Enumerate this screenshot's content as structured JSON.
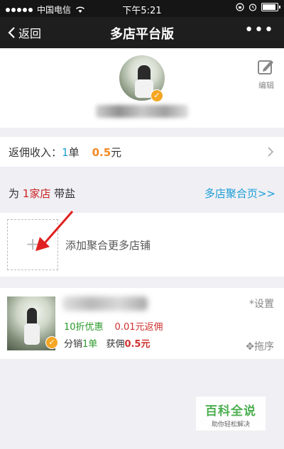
{
  "status_bar": {
    "carrier": "中国电信",
    "time": "下午5:21"
  },
  "nav": {
    "back_label": "返回",
    "title": "多店平台版",
    "more_label": "•••"
  },
  "profile": {
    "edit_label": "编辑"
  },
  "income": {
    "label": "返佣收入：",
    "orders_count": "1",
    "orders_unit": "单",
    "amount_value": "0.5",
    "amount_unit": "元"
  },
  "stores_header": {
    "prefix": "为 ",
    "count_text": "1家店",
    "suffix": " 带盐",
    "link_label": "多店聚合页>>"
  },
  "add_store": {
    "plus": "+",
    "label": "添加聚合更多店铺"
  },
  "store_card": {
    "settings_label": "设置",
    "discount": "10折优惠",
    "rebate_value": "0.01元",
    "rebate_suffix": "返佣",
    "dist_prefix": "分销",
    "dist_count": "1单",
    "earn_prefix": "获佣",
    "earn_value": "0.5元",
    "sort_label": "拖序"
  },
  "watermark": {
    "title": "百科全说",
    "subtitle": "助你轻松解决"
  },
  "colors": {
    "accent_blue": "#1a9ed6",
    "accent_orange": "#f08a24",
    "accent_red": "#cc2222",
    "accent_green": "#2a9a2a",
    "badge_orange": "#f5a623"
  }
}
